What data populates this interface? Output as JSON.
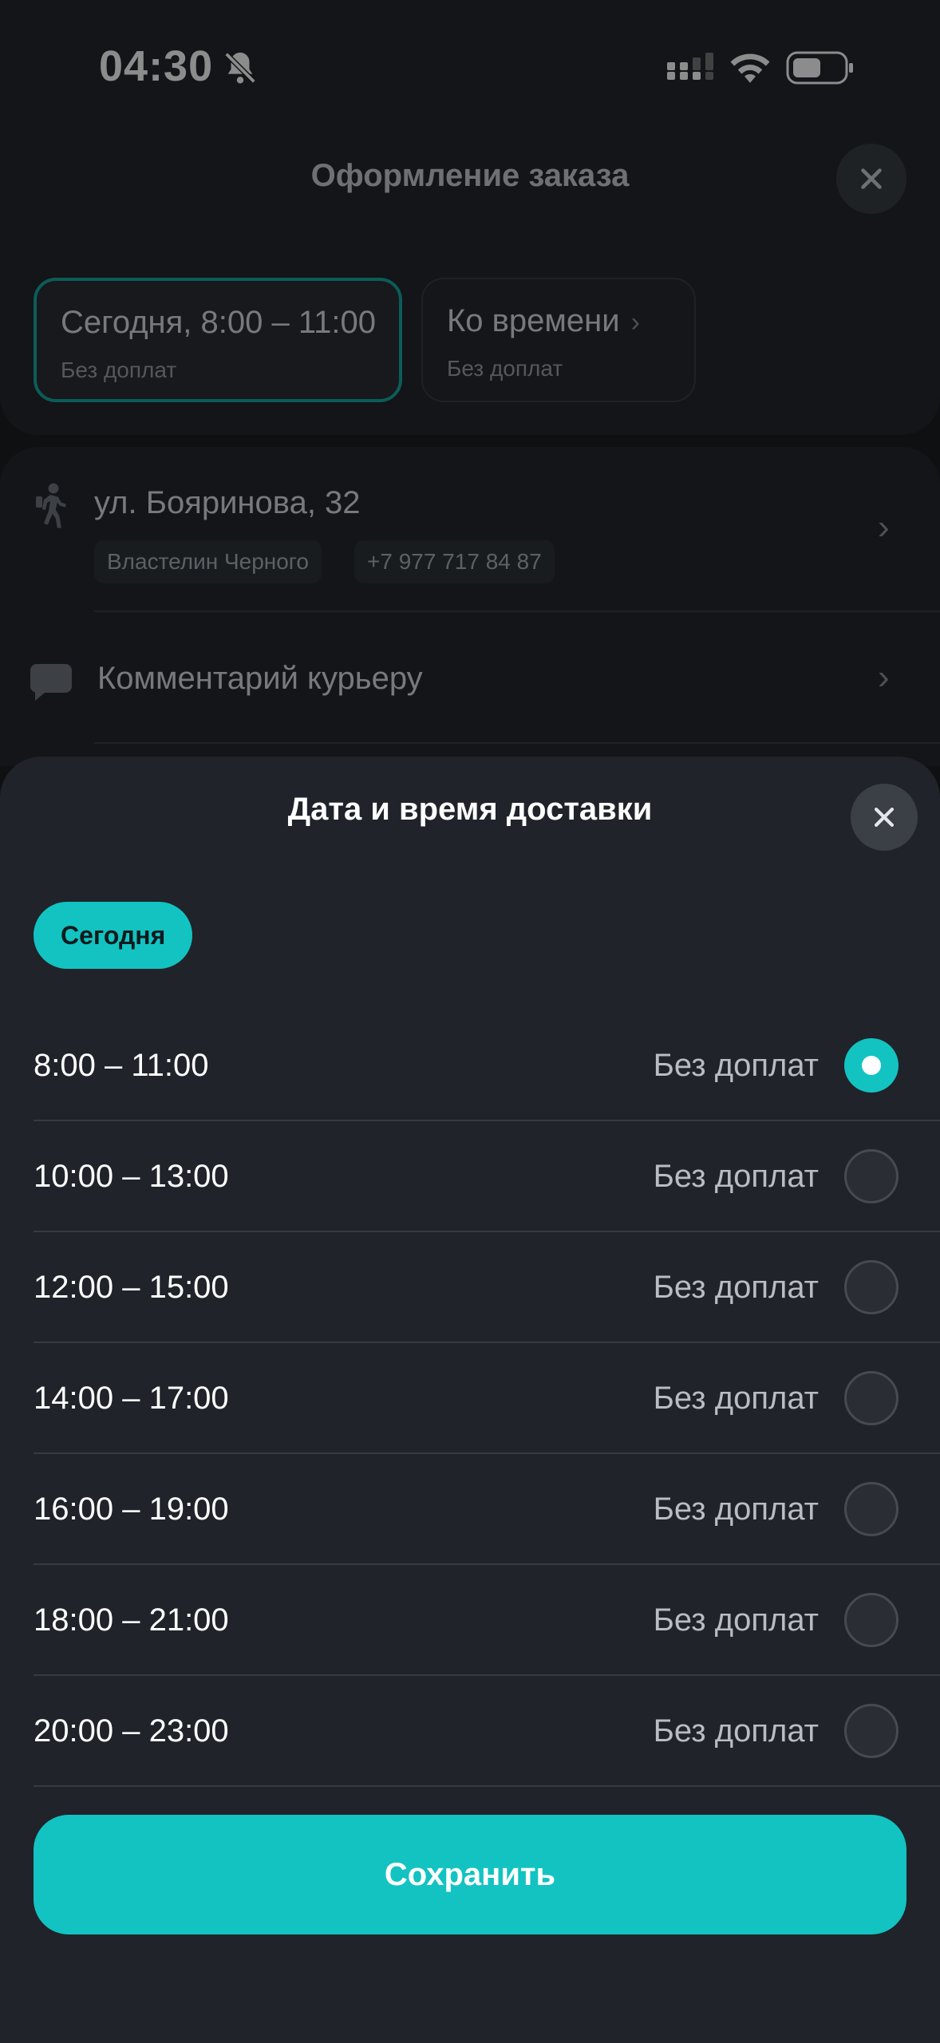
{
  "status_bar": {
    "time": "04:30"
  },
  "page": {
    "title": "Оформление заказа",
    "delivery_options": [
      {
        "main": "Сегодня, 8:00 – 11:00",
        "sub": "Без доплат",
        "selected": true
      },
      {
        "main": "Ко времени",
        "sub": "Без доплат",
        "selected": false
      }
    ],
    "address": "ул. Бояринова, 32",
    "recipient_name": "Властелин Черного",
    "recipient_phone": "+7 977 717 84 87",
    "comment_label": "Комментарий курьеру"
  },
  "sheet": {
    "title": "Дата и время доставки",
    "day_chip": "Сегодня",
    "slots": [
      {
        "time": "8:00 – 11:00",
        "price": "Без доплат",
        "selected": true
      },
      {
        "time": "10:00 – 13:00",
        "price": "Без доплат",
        "selected": false
      },
      {
        "time": "12:00 – 15:00",
        "price": "Без доплат",
        "selected": false
      },
      {
        "time": "14:00 – 17:00",
        "price": "Без доплат",
        "selected": false
      },
      {
        "time": "16:00 – 19:00",
        "price": "Без доплат",
        "selected": false
      },
      {
        "time": "18:00 – 21:00",
        "price": "Без доплат",
        "selected": false
      },
      {
        "time": "20:00 – 23:00",
        "price": "Без доплат",
        "selected": false
      }
    ],
    "save_label": "Сохранить"
  },
  "colors": {
    "accent": "#12c3c2",
    "sheet_bg": "#202329",
    "page_bg": "#1c1e22"
  }
}
